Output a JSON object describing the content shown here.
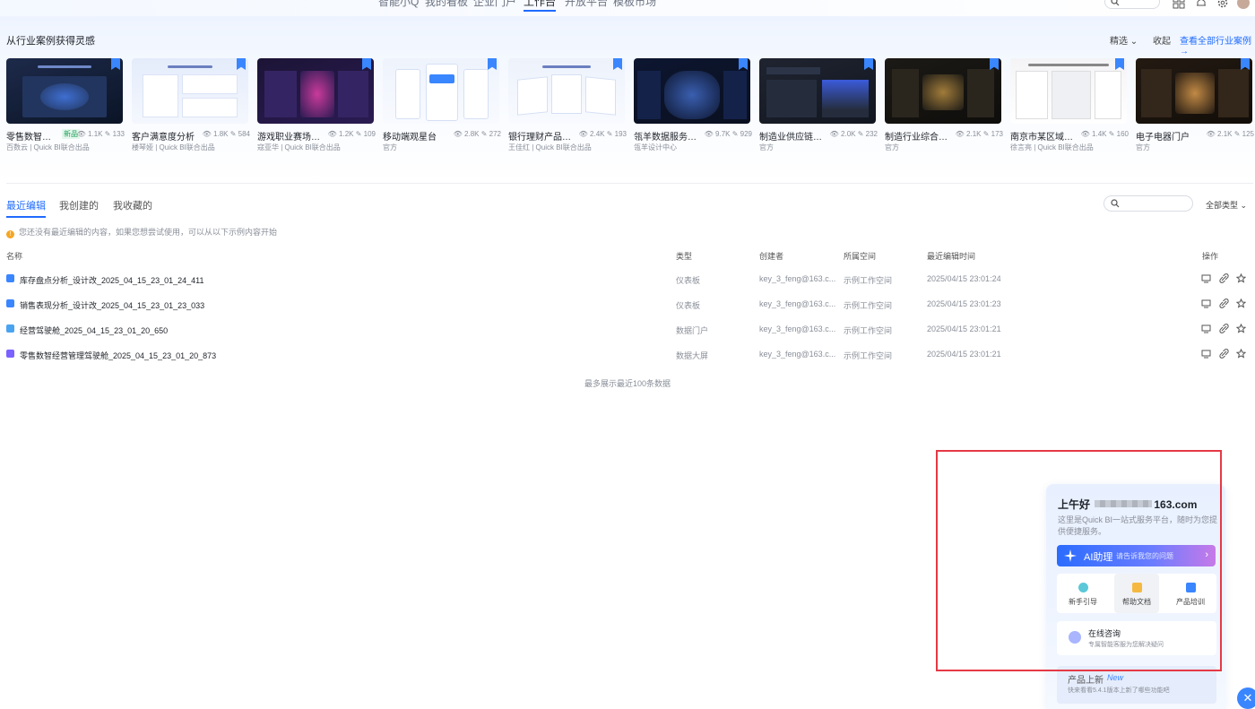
{
  "nav": {
    "tabs": [
      "智能小Q",
      "我的看板",
      "企业门户",
      "工作台",
      "开放平台",
      "模板市场"
    ],
    "active_tab": "工作台"
  },
  "inspiration": {
    "title": "从行业案例获得灵感",
    "filter": "精选",
    "collapse": "收起",
    "view_all": "查看全部行业案例 →",
    "cards": [
      {
        "title": "零售数智经...",
        "badge": "新品",
        "views": "1.1K",
        "edits": "133",
        "author": "百数云 | Quick BI联合出品"
      },
      {
        "title": "客户满意度分析",
        "views": "1.8K",
        "edits": "584",
        "author": "楼琴娅 | Quick BI联合出品"
      },
      {
        "title": "游戏职业赛场数据...",
        "views": "1.2K",
        "edits": "109",
        "author": "寇亚华 | Quick BI联合出品"
      },
      {
        "title": "移动端观星台",
        "views": "2.8K",
        "edits": "272",
        "author": "官方"
      },
      {
        "title": "银行理财产品分析...",
        "views": "2.4K",
        "edits": "193",
        "author": "王佳红 | Quick BI联合出品"
      },
      {
        "title": "瓴羊数据服务态势...",
        "views": "9.7K",
        "edits": "929",
        "author": "瓴羊设计中心"
      },
      {
        "title": "制造业供应链门户",
        "views": "2.0K",
        "edits": "232",
        "author": "官方"
      },
      {
        "title": "制造行业综合分析...",
        "views": "2.1K",
        "edits": "173",
        "author": "官方"
      },
      {
        "title": "南京市某区域房屋...",
        "views": "1.4K",
        "edits": "160",
        "author": "徐言亮 | Quick BI联合出品"
      },
      {
        "title": "电子电器门户",
        "views": "2.1K",
        "edits": "125",
        "author": "官方"
      }
    ]
  },
  "list": {
    "tabs": [
      "最近编辑",
      "我创建的",
      "我收藏的"
    ],
    "active_tab": "最近编辑",
    "type_filter": "全部类型",
    "notice": "您还没有最近编辑的内容，如果您想尝试使用，可以从以下示例内容开始",
    "columns": {
      "name": "名称",
      "type": "类型",
      "creator": "创建者",
      "space": "所属空间",
      "time": "最近编辑时间",
      "ops": "操作"
    },
    "rows": [
      {
        "name": "库存盘点分析_设计改_2025_04_15_23_01_24_411",
        "type": "仪表板",
        "creator": "key_3_feng@163.c...",
        "space": "示例工作空间",
        "time": "2025/04/15 23:01:24"
      },
      {
        "name": "销售表现分析_设计改_2025_04_15_23_01_23_033",
        "type": "仪表板",
        "creator": "key_3_feng@163.c...",
        "space": "示例工作空间",
        "time": "2025/04/15 23:01:23"
      },
      {
        "name": "经营驾驶舱_2025_04_15_23_01_20_650",
        "type": "数据门户",
        "creator": "key_3_feng@163.c...",
        "space": "示例工作空间",
        "time": "2025/04/15 23:01:21"
      },
      {
        "name": "零售数智经营管理驾驶舱_2025_04_15_23_01_20_873",
        "type": "数据大屏",
        "creator": "key_3_feng@163.c...",
        "space": "示例工作空间",
        "time": "2025/04/15 23:01:21"
      }
    ],
    "footnote": "最多展示最近100条数据"
  },
  "assistant": {
    "greeting_prefix": "上午好",
    "greeting_suffix": "163.com",
    "intro": "这里是Quick BI一站式服务平台，随时为您提供便捷服务。",
    "ai_label": "AI助理",
    "ai_hint": "请告诉我您的问题",
    "quick": [
      "新手引导",
      "帮助文档",
      "产品培训"
    ],
    "consult_title": "在线咨询",
    "consult_sub": "专属智能客服为您解决疑问",
    "news_title": "产品上新",
    "news_tag": "New",
    "news_sub": "快来看看5.4.1版本上新了哪些功能吧"
  },
  "colors": {
    "accent": "#1f6bff",
    "highlight": "#e53945"
  }
}
